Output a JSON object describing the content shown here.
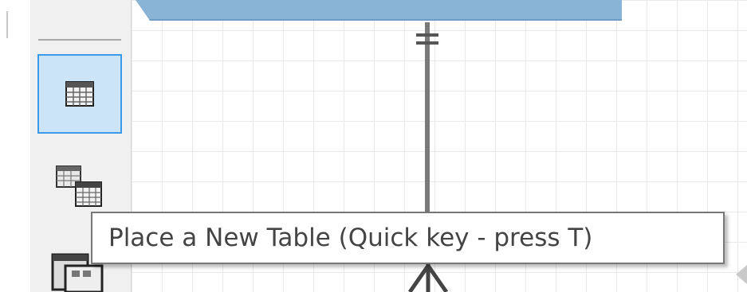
{
  "toolbar": {
    "tools": [
      {
        "name": "new-table",
        "icon": "table-grid-icon",
        "selected": true
      },
      {
        "name": "new-view",
        "icon": "view-tables-icon",
        "selected": false
      },
      {
        "name": "relationship",
        "icon": "relationship-icon",
        "selected": false
      }
    ]
  },
  "tooltip": {
    "text": "Place a New Table (Quick key - press T)"
  },
  "colors": {
    "selected_bg": "#cce4f7",
    "selected_border": "#3d9ae8",
    "table_header": "#8ab4d6",
    "connector": "#7a7a7a",
    "tooltip_border": "#777777"
  }
}
